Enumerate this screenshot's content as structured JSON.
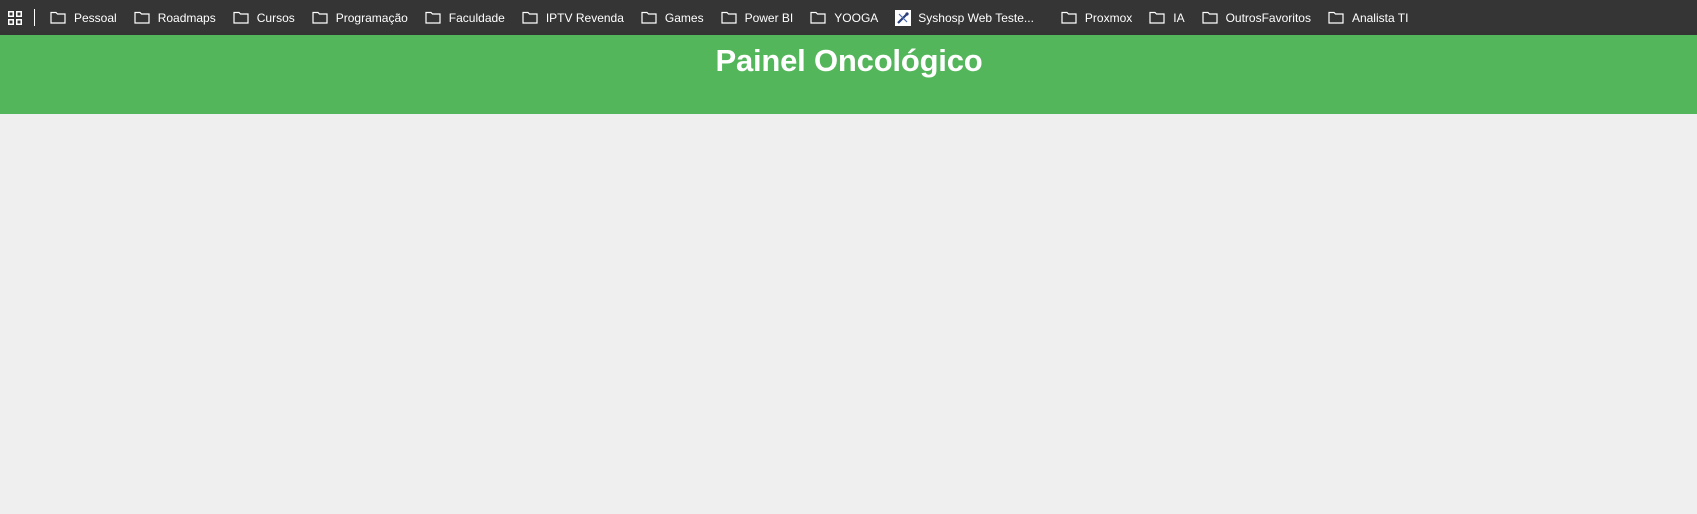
{
  "bookmarks_bar": {
    "items": [
      {
        "label": "Pessoal",
        "icon": "folder-icon"
      },
      {
        "label": "Roadmaps",
        "icon": "folder-icon"
      },
      {
        "label": "Cursos",
        "icon": "folder-icon"
      },
      {
        "label": "Programação",
        "icon": "folder-icon"
      },
      {
        "label": "Faculdade",
        "icon": "folder-icon"
      },
      {
        "label": "IPTV Revenda",
        "icon": "folder-icon"
      },
      {
        "label": "Games",
        "icon": "folder-icon"
      },
      {
        "label": "Power BI",
        "icon": "folder-icon"
      },
      {
        "label": "YOOGA",
        "icon": "folder-icon"
      },
      {
        "label": "Syshosp Web Teste...",
        "icon": "site-favicon"
      },
      {
        "label": "Proxmox",
        "icon": "folder-icon"
      },
      {
        "label": "IA",
        "icon": "folder-icon"
      },
      {
        "label": "OutrosFavoritos",
        "icon": "folder-icon"
      },
      {
        "label": "Analista TI",
        "icon": "folder-icon"
      }
    ]
  },
  "header": {
    "title": "Painel Oncológico"
  },
  "colors": {
    "bookmarks_bar_bg": "#353535",
    "header_bg": "#54b65b",
    "page_bg": "#efefef"
  }
}
